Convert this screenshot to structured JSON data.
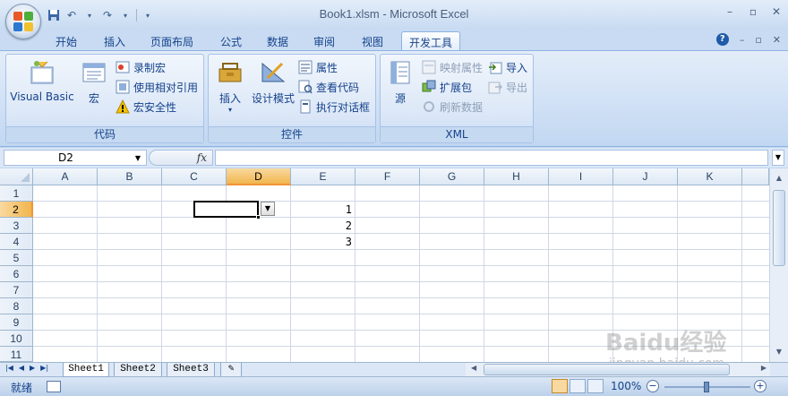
{
  "title": "Book1.xlsm - Microsoft Excel",
  "tabs": [
    "开始",
    "插入",
    "页面布局",
    "公式",
    "数据",
    "审阅",
    "视图",
    "开发工具"
  ],
  "active_tab": "开发工具",
  "ribbon": {
    "groups": [
      {
        "label": "代码",
        "big_buttons": [
          "Visual Basic",
          "宏"
        ],
        "small_buttons": [
          "录制宏",
          "使用相对引用",
          "宏安全性"
        ]
      },
      {
        "label": "控件",
        "big_buttons": [
          "插入",
          "设计模式"
        ],
        "small_buttons": [
          "属性",
          "查看代码",
          "执行对话框"
        ]
      },
      {
        "label": "XML",
        "big_buttons": [
          "源"
        ],
        "small_buttons": [
          "映射属性",
          "扩展包",
          "刷新数据",
          "导入",
          "导出"
        ]
      }
    ]
  },
  "formula_bar": {
    "name_box": "D2",
    "fx": "fx",
    "formula": ""
  },
  "columns": [
    "A",
    "B",
    "C",
    "D",
    "E",
    "F",
    "G",
    "H",
    "I",
    "J",
    "K"
  ],
  "rows": [
    "1",
    "2",
    "3",
    "4",
    "5",
    "6",
    "7",
    "8",
    "9",
    "10",
    "11"
  ],
  "active_cell": {
    "column": "D",
    "row": "2"
  },
  "cells": {
    "E2": "1",
    "E3": "2",
    "E4": "3"
  },
  "sheets": [
    "Sheet1",
    "Sheet2",
    "Sheet3"
  ],
  "active_sheet": "Sheet1",
  "status": {
    "mode": "就绪",
    "zoom": "100%"
  },
  "watermark": {
    "logo": "Baidu经验",
    "url": "jingyan.baidu.com"
  },
  "colors": {
    "ribbon_bg": "#dbe7f7",
    "tab_text": "#15428b",
    "active_header": "#f1b64d"
  }
}
